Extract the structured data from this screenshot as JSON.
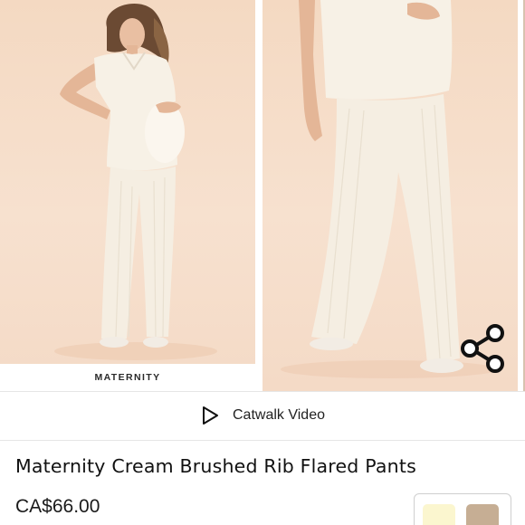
{
  "gallery": {
    "images": [
      {
        "label": "MATERNITY",
        "colors": {
          "background": "#f5dcc7",
          "garment": "#f6efe4"
        }
      },
      {
        "label": "",
        "colors": {
          "background": "#f5dcc7",
          "garment": "#f6efe4"
        }
      }
    ],
    "share_icon": "share-icon"
  },
  "video": {
    "label": "Catwalk Video",
    "icon": "play-icon"
  },
  "product": {
    "title": "Maternity Cream Brushed Rib Flared Pants",
    "price": "CA$66.00"
  },
  "swatches": [
    {
      "name": "cream",
      "color": "#fbf6cf"
    },
    {
      "name": "mocha",
      "color": "#c6ae94"
    }
  ]
}
